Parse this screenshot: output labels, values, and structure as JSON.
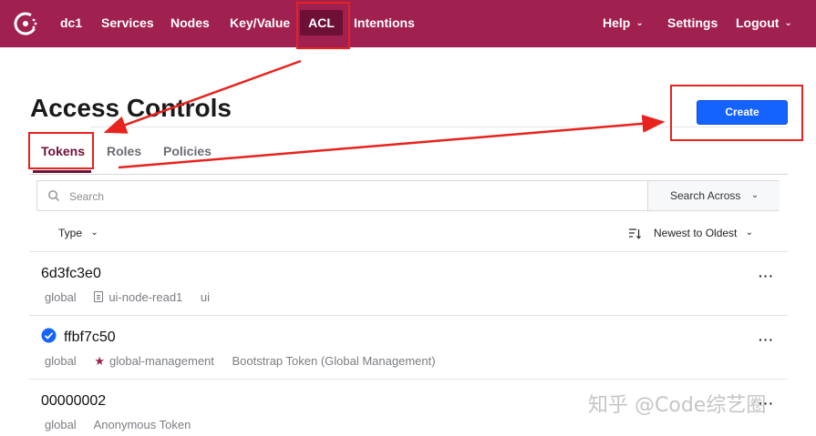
{
  "nav": {
    "datacenter": "dc1",
    "items": [
      "Services",
      "Nodes",
      "Key/Value",
      "ACL",
      "Intentions"
    ],
    "right": [
      "Help",
      "Settings",
      "Logout"
    ]
  },
  "page": {
    "title": "Access Controls",
    "create_label": "Create"
  },
  "tabs": [
    "Tokens",
    "Roles",
    "Policies"
  ],
  "search": {
    "placeholder": "Search",
    "across_label": "Search Across"
  },
  "filters": {
    "type_label": "Type",
    "sort_label": "Newest to Oldest"
  },
  "rows": [
    {
      "id": "6d3fc3e0",
      "scope": "global",
      "policy": "ui-node-read1",
      "description": "ui",
      "policy_icon": "document-icon"
    },
    {
      "id": "ffbf7c50",
      "scope": "global",
      "policy": "global-management",
      "description": "Bootstrap Token (Global Management)",
      "policy_icon": "star-icon",
      "current": true
    },
    {
      "id": "00000002",
      "scope": "global",
      "policy": "",
      "description": "Anonymous Token"
    }
  ],
  "row_menu": "···",
  "watermark": "知乎 @Code综艺圈",
  "colors": {
    "nav_bg": "#a02050",
    "nav_active": "#6e1036",
    "primary_button": "#1563ff",
    "annotation": "#e8221d"
  }
}
